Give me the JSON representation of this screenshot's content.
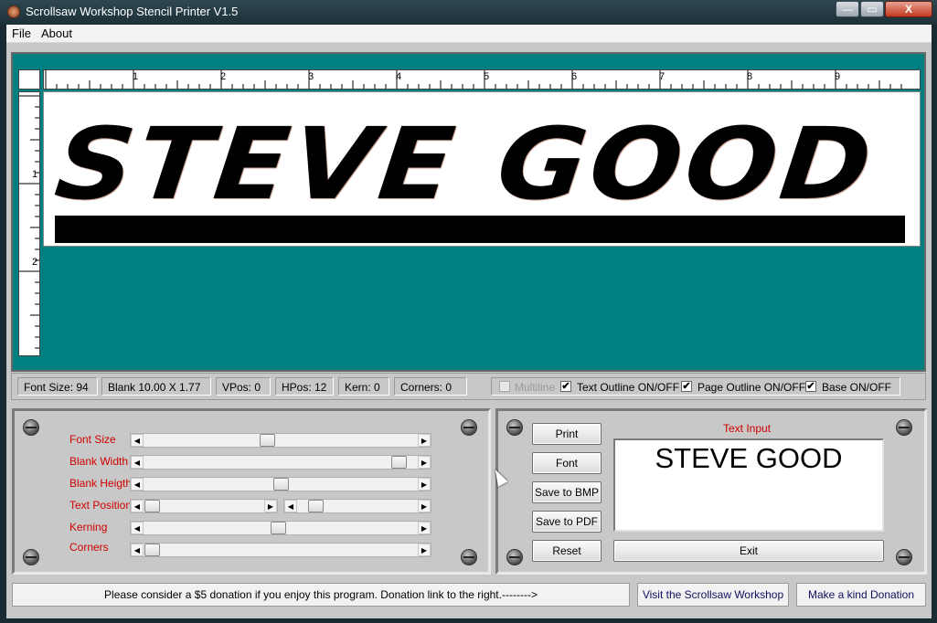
{
  "window": {
    "title": "Scrollsaw Workshop Stencil Printer V1.5",
    "minimize_glyph": "—",
    "maximize_glyph": "▭",
    "close_glyph": "X"
  },
  "menu": {
    "file": "File",
    "about": "About"
  },
  "rulers": {
    "horizontal_labels": [
      "1",
      "2",
      "3",
      "4",
      "5",
      "6",
      "7",
      "8",
      "9"
    ],
    "vertical_labels": [
      "1",
      "2"
    ]
  },
  "stencil": {
    "text": "STEVE GOOD",
    "base_on": true
  },
  "status": {
    "font_size": "Font Size: 94",
    "blank": "Blank 10.00  X 1.77",
    "vpos": "VPos: 0",
    "hpos": "HPos: 12",
    "kern": "Kern: 0",
    "corners": "Corners: 0"
  },
  "options": {
    "multiline": {
      "label": "Multiline",
      "checked": false,
      "enabled": false
    },
    "text_outline": {
      "label": "Text Outline ON/OFF",
      "checked": true
    },
    "page_outline": {
      "label": "Page Outline ON/OFF",
      "checked": true
    },
    "base": {
      "label": "Base ON/OFF",
      "checked": true
    },
    "check_glyph": "✔"
  },
  "sliders": {
    "font_size": {
      "label": "Font Size",
      "value": 0.45
    },
    "blank_width": {
      "label": "Blank Width",
      "value": 0.96
    },
    "blank_height": {
      "label": "Blank Heigth",
      "value": 0.5
    },
    "text_position": {
      "label": "Text Position",
      "value_v": 0.0,
      "value_h": 0.1
    },
    "kerning": {
      "label": "Kerning",
      "value": 0.49
    },
    "corners": {
      "label": "Corners",
      "value": 0.0
    },
    "left_arrow": "◀",
    "right_arrow": "▶"
  },
  "buttons": {
    "print": "Print",
    "font": "Font",
    "save_bmp": "Save to BMP",
    "save_pdf": "Save to PDF",
    "reset": "Reset",
    "exit": "Exit"
  },
  "text_input": {
    "label": "Text Input",
    "value": "STEVE GOOD"
  },
  "footer": {
    "message": "Please consider a $5 donation if you enjoy this program. Donation link to the right.-------->",
    "visit": "Visit the Scrollsaw Workshop",
    "donate": "Make a kind Donation"
  },
  "colors": {
    "canvas_bg": "#008080",
    "label_red": "#d00000",
    "panel_gray": "#c8c8c8"
  }
}
